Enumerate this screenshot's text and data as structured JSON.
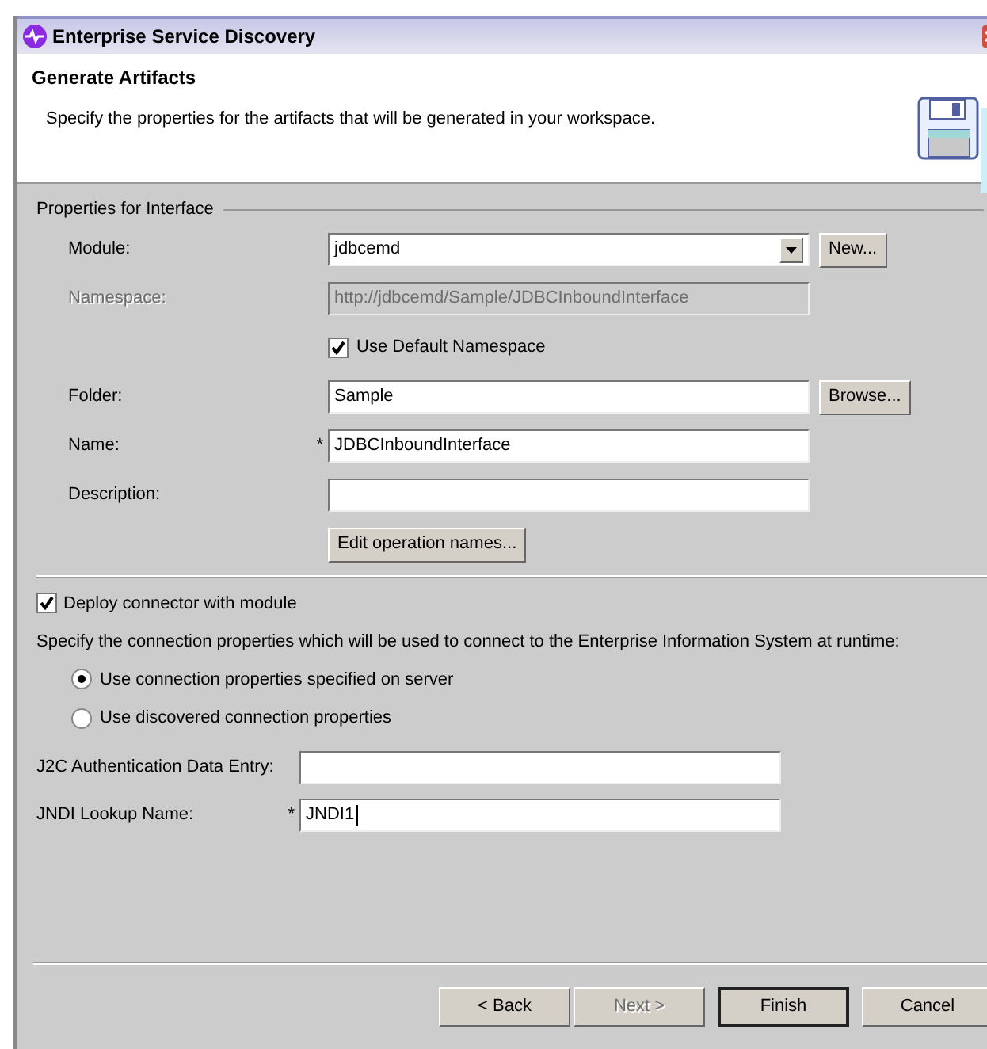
{
  "window": {
    "title": "Enterprise Service Discovery"
  },
  "header": {
    "title": "Generate Artifacts",
    "description": "Specify the properties for the artifacts that will be generated in your workspace."
  },
  "interface_group": {
    "title": "Properties for Interface",
    "rows": [
      {
        "kind": "combo",
        "label": "Module:",
        "value": "jdbcemd",
        "disabled": false,
        "button": "New..."
      },
      {
        "kind": "field",
        "label": "Namespace:",
        "value": "http://jdbcemd/Sample/JDBCInboundInterface",
        "disabled": true
      },
      {
        "kind": "checkbox",
        "label": "Use Default Namespace",
        "checked": true
      },
      {
        "kind": "field",
        "label": "Folder:",
        "value": "Sample",
        "disabled": false,
        "button": "Browse..."
      },
      {
        "kind": "field",
        "label": "Name:",
        "value": "JDBCInboundInterface",
        "disabled": false,
        "required_mark": "*"
      },
      {
        "kind": "field",
        "label": "Description:",
        "disabled": false
      },
      {
        "kind": "button",
        "label": "Edit operation names..."
      }
    ]
  },
  "deploy": {
    "label": "Deploy connector with module",
    "checked": true
  },
  "connection_prompt": "Specify the connection properties which will be used to connect to the Enterprise Information System at runtime:",
  "connection_options": [
    {
      "label": "Use connection properties specified on server",
      "selected": true
    },
    {
      "label": "Use discovered connection properties",
      "selected": false
    }
  ],
  "auth_fields": [
    {
      "label": "J2C Authentication Data Entry:",
      "focused": false
    },
    {
      "label": "JNDI Lookup Name:",
      "value": "JNDI1",
      "required_mark": "*",
      "focused": true
    }
  ],
  "buttons": [
    {
      "label": "< Back",
      "disabled": false,
      "default": false
    },
    {
      "label": "Next >",
      "disabled": true,
      "default": false
    },
    {
      "label": "Finish",
      "disabled": false,
      "default": true
    },
    {
      "label": "Cancel",
      "disabled": false,
      "default": false
    }
  ]
}
